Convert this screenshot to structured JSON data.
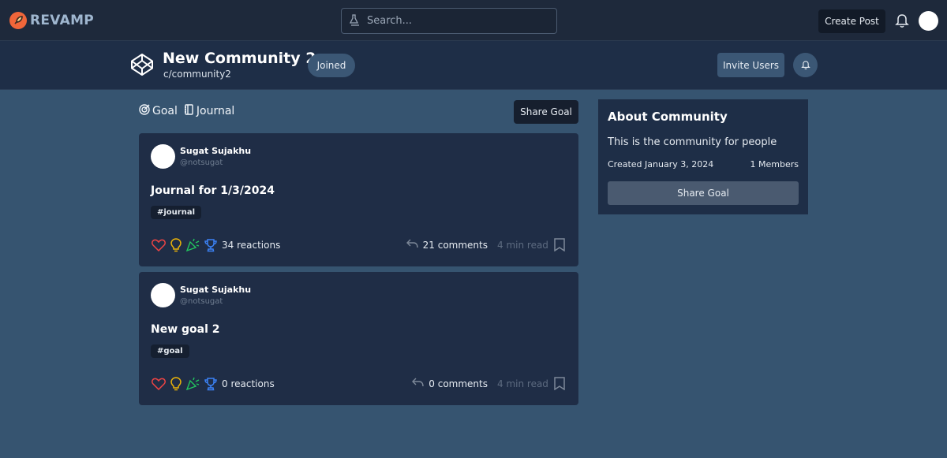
{
  "brand": {
    "name": "REVAMP"
  },
  "search": {
    "placeholder": "Search..."
  },
  "topbar": {
    "create_post": "Create Post"
  },
  "community": {
    "name": "New Community 2",
    "slug": "c/community2",
    "joined_label": "Joined",
    "invite_label": "Invite Users"
  },
  "tabs": [
    {
      "label": "Goal",
      "icon": "target-icon"
    },
    {
      "label": "Journal",
      "icon": "notebook-icon"
    }
  ],
  "share_goal_label": "Share Goal",
  "posts": [
    {
      "author": "Sugat Sujakhu",
      "handle": "@notsugat",
      "title": "Journal for 1/3/2024",
      "tag": "#journal",
      "reactions": "34 reactions",
      "comments": "21 comments",
      "read_time": "4 min read"
    },
    {
      "author": "Sugat Sujakhu",
      "handle": "@notsugat",
      "title": "New goal 2",
      "tag": "#goal",
      "reactions": "0 reactions",
      "comments": "0 comments",
      "read_time": "4 min read"
    }
  ],
  "about": {
    "title": "About Community",
    "description": "This is the community for people",
    "created": "Created January 3, 2024",
    "members": "1 Members",
    "share_label": "Share Goal"
  },
  "colors": {
    "background": "#365470",
    "topbar": "#1e293b",
    "card": "#1f2d46",
    "heart": "#ef4444",
    "bulb": "#eab308",
    "party": "#22c55e",
    "trophy": "#3b82f6"
  }
}
